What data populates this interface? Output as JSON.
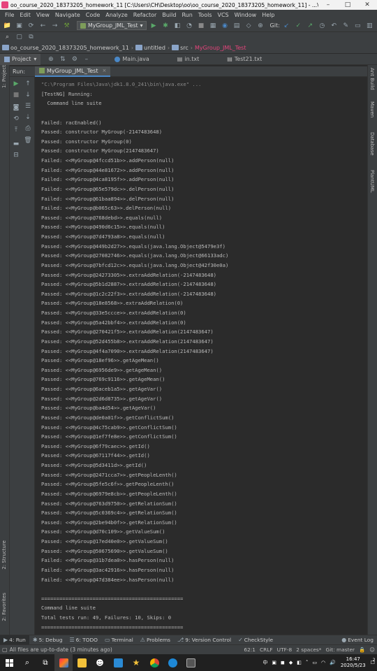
{
  "window": {
    "title": "oo_course_2020_18373205_homework_11 [C:\\Users\\CH\\Desktop\\oo\\oo_course_2020_18373205_homework_11] - ...\\u...",
    "controls": [
      "–",
      "□",
      "✕"
    ]
  },
  "menu": [
    "File",
    "Edit",
    "View",
    "Navigate",
    "Code",
    "Analyze",
    "Refactor",
    "Build",
    "Run",
    "Tools",
    "VCS",
    "Window",
    "Help"
  ],
  "toolbar": {
    "run_config": "MyGroup_JML_Test",
    "git_label": "Git:"
  },
  "breadcrumb": {
    "project": "oo_course_2020_18373205_homework_11",
    "module": "untitled",
    "folder": "src",
    "file": "MyGroup_JML_Test"
  },
  "tabs": {
    "project_button": "Project",
    "editor_tabs": [
      "Main.java",
      "in.txt",
      "Test21.txt"
    ]
  },
  "side_panels": {
    "left_top": "1: Project",
    "left_middle": "2: Structure",
    "left_bottom": "2: Favorites",
    "right": [
      "Ant Build",
      "Maven",
      "Database",
      "PlantUML"
    ]
  },
  "run_panel": {
    "label": "Run:",
    "tab": "MyGroup_JML_Test",
    "close": "×"
  },
  "console": [
    "\"C:\\Program Files\\Java\\jdk1.8.0_241\\bin\\java.exe\" ...",
    "[TestNG] Running:",
    "  Command line suite",
    "",
    "Failed: racEnabled()",
    "Passed: constructor MyGroup(-2147483648)",
    "Passed: constructor MyGroup(0)",
    "Passed: constructor MyGroup(2147483647)",
    "Failed: <<MyGroup@4fccd51b>>.addPerson(null)",
    "Failed: <<MyGroup@44e81672>>.addPerson(null)",
    "Failed: <<MyGroup@4ca8195f>>.addPerson(null)",
    "Failed: <<MyGroup@65e579dc>>.delPerson(null)",
    "Failed: <<MyGroup@61baa894>>.delPerson(null)",
    "Failed: <<MyGroup@b065c63>>.delPerson(null)",
    "Passed: <<MyGroup@768debd>>.equals(null)",
    "Passed: <<MyGroup@490d6c15>>.equals(null)",
    "Passed: <<MyGroup@7d4793a8>>.equals(null)",
    "Passed: <<MyGroup@449b2d27>>.equals(java.lang.Object@5479e3f)",
    "Passed: <<MyGroup@27082746>>.equals(java.lang.Object@66133adc)",
    "Passed: <<MyGroup@7bfcd12c>>.equals(java.lang.Object@42f30e0a)",
    "Passed: <<MyGroup@24273305>>.extraAddRelation(-2147483648)",
    "Passed: <<MyGroup@5b1d2887>>.extraAddRelation(-2147483648)",
    "Passed: <<MyGroup@1c2c22f3>>.extraAddRelation(-2147483648)",
    "Passed: <<MyGroup@18e8568>>.extraAddRelation(0)",
    "Passed: <<MyGroup@33e5ccce>>.extraAddRelation(0)",
    "Passed: <<MyGroup@5a42bbf4>>.extraAddRelation(0)",
    "Passed: <<MyGroup@270421f5>>.extraAddRelation(2147483647)",
    "Passed: <<MyGroup@52d455b8>>.extraAddRelation(2147483647)",
    "Passed: <<MyGroup@4f4a7090>>.extraAddRelation(2147483647)",
    "Passed: <<MyGroup@18ef96>>.getAgeMean()",
    "Passed: <<MyGroup@6956de9>>.getAgeMean()",
    "Passed: <<MyGroup@769c9116>>.getAgeMean()",
    "Passed: <<MyGroup@6aceb1a5>>.getAgeVar()",
    "Passed: <<MyGroup@2d6d8735>>.getAgeVar()",
    "Passed: <<MyGroup@ba4d54>>.getAgeVar()",
    "Passed: <<MyGroup@de0a01f>>.getConflictSum()",
    "Passed: <<MyGroup@4c75cab9>>.getConflictSum()",
    "Passed: <<MyGroup@1ef7fe8e>>.getConflictSum()",
    "Passed: <<MyGroup@6f79caec>>.getId()",
    "Passed: <<MyGroup@67117f44>>.getId()",
    "Passed: <<MyGroup@5d3411d>>.getId()",
    "Passed: <<MyGroup@2471cca7>>.getPeopleLenth()",
    "Passed: <<MyGroup@5fe5c6f>>.getPeopleLenth()",
    "Passed: <<MyGroup@6979e8cb>>.getPeopleLenth()",
    "Passed: <<MyGroup@763d9750>>.getRelationSum()",
    "Passed: <<MyGroup@5c0369c4>>.getRelationSum()",
    "Passed: <<MyGroup@2be94b0f>>.getRelationSum()",
    "Passed: <<MyGroup@d70c109>>.getValueSum()",
    "Passed: <<MyGroup@17ed40e0>>.getValueSum()",
    "Passed: <<MyGroup@50675690>>.getValueSum()",
    "Failed: <<MyGroup@31b7dea0>>.hasPerson(null)",
    "Failed: <<MyGroup@3ac42916>>.hasPerson(null)",
    "Failed: <<MyGroup@47d384ee>>.hasPerson(null)",
    "",
    "===============================================",
    "Command line suite",
    "Total tests run: 49, Failures: 10, Skips: 0",
    "==============================================="
  ],
  "bottom_tools": [
    {
      "label": "4: Run",
      "icon": "run-icon",
      "glyph": "▶"
    },
    {
      "label": "5: Debug",
      "icon": "debug-icon",
      "glyph": "✱"
    },
    {
      "label": "6: TODO",
      "icon": "todo-icon",
      "glyph": "☰"
    },
    {
      "label": "Terminal",
      "icon": "terminal-icon",
      "glyph": "▭"
    },
    {
      "label": "Problems",
      "icon": "problems-icon",
      "glyph": "⚠"
    },
    {
      "label": "9: Version Control",
      "icon": "vcs-icon",
      "glyph": "⎇"
    },
    {
      "label": "CheckStyle",
      "icon": "checkstyle-icon",
      "glyph": "✓"
    },
    {
      "label": "Event Log",
      "icon": "event-log-icon",
      "glyph": "●"
    }
  ],
  "status": {
    "message": "All files are up-to-date (3 minutes ago)",
    "position": "62:1",
    "line_sep": "CRLF",
    "encoding": "UTF-8",
    "indent": "2 spaces*",
    "branch": "Git: master"
  },
  "taskbar": {
    "input_method": "中",
    "time": "16:47",
    "date": "2020/5/23",
    "notifications": "2"
  }
}
